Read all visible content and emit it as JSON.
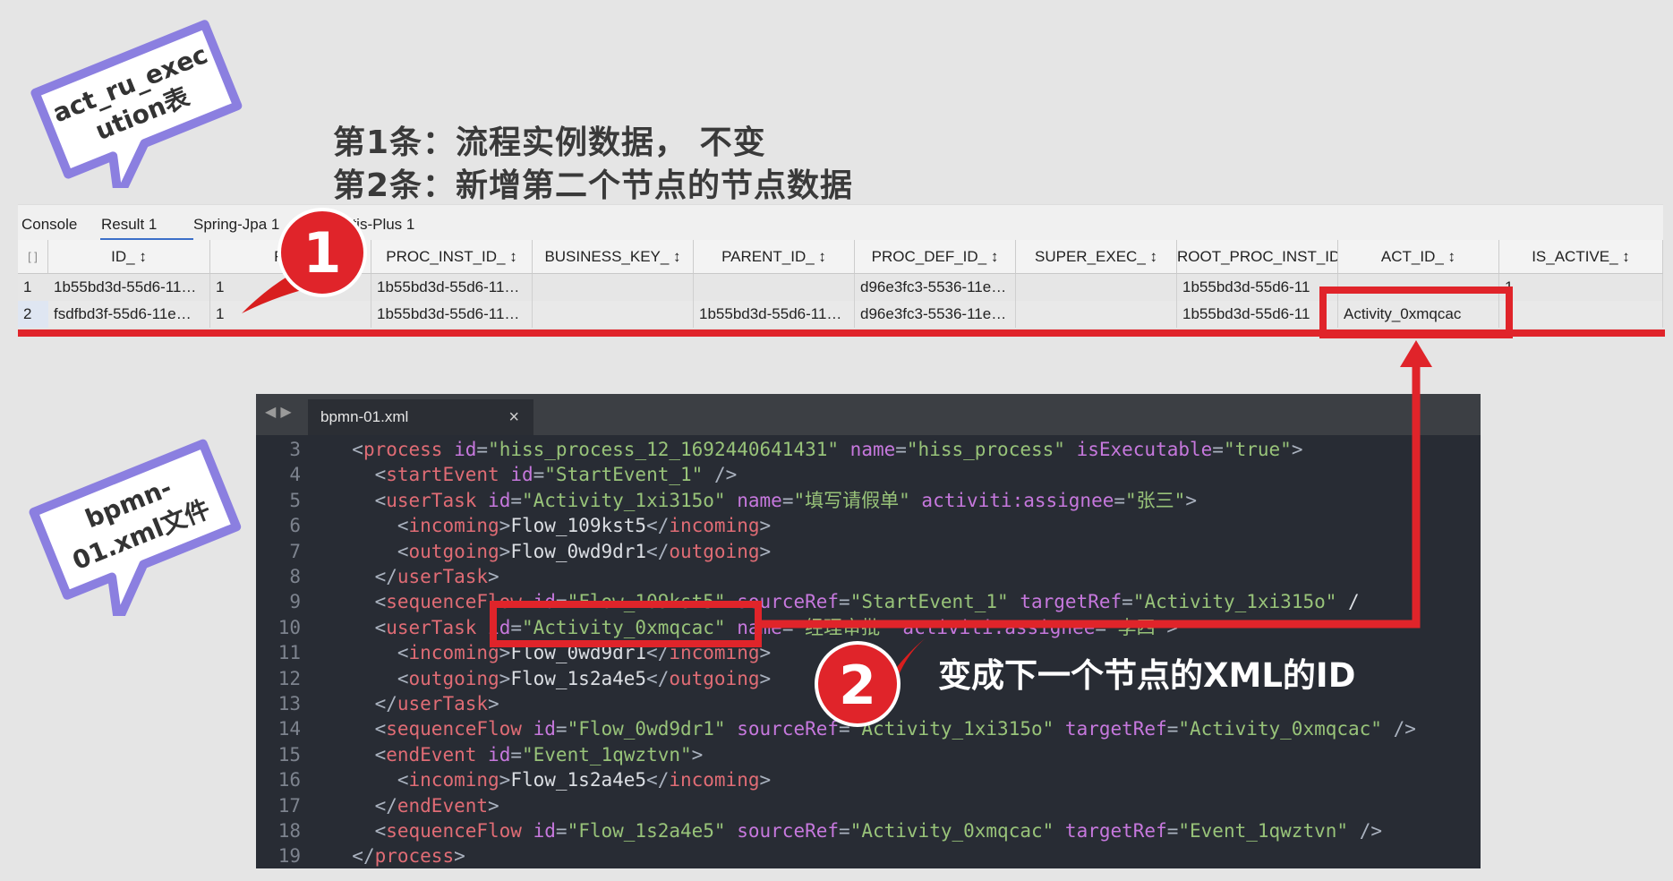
{
  "bubbles": {
    "top": "act_ru_exec\nution表",
    "bottom": "bpmn-\n01.xml文件"
  },
  "heading": {
    "line1": "第1条：流程实例数据， 不变",
    "line2": "第2条：新增第二个节点的节点数据"
  },
  "tabs": [
    "Console",
    "Result 1",
    "Spring-Jpa 1",
    "atis-Plus 1"
  ],
  "callout_numbers": [
    "1",
    "2"
  ],
  "annotation": "变成下一个节点的XML的ID",
  "table": {
    "row_header_icon": "[ ]",
    "columns": [
      "ID_",
      "RE",
      "PROC_INST_ID_",
      "BUSINESS_KEY_",
      "PARENT_ID_",
      "PROC_DEF_ID_",
      "SUPER_EXEC_",
      "ROOT_PROC_INST_ID_",
      "ACT_ID_",
      "IS_ACTIVE_"
    ],
    "rows": [
      {
        "num": "1",
        "cells": [
          "1b55bd3d-55d6-11…",
          "1",
          "1b55bd3d-55d6-11…",
          "",
          "",
          "d96e3fc3-5536-11e…",
          "",
          "1b55bd3d-55d6-11",
          "",
          "1"
        ]
      },
      {
        "num": "2",
        "cells": [
          "fsdfbd3f-55d6-11e…",
          "1",
          "1b55bd3d-55d6-11…",
          "",
          "1b55bd3d-55d6-11…",
          "d96e3fc3-5536-11e…",
          "",
          "1b55bd3d-55d6-11",
          "Activity_0xmqcac",
          ""
        ]
      }
    ]
  },
  "editor": {
    "tab": "bpmn-01.xml",
    "close": "×",
    "nav": "◀ ▶",
    "line_numbers": [
      "3",
      "4",
      "5",
      "6",
      "7",
      "8",
      "9",
      "10",
      "11",
      "12",
      "13",
      "14",
      "15",
      "16",
      "17",
      "18",
      "19"
    ],
    "lines": [
      "<process id=\"hiss_process_12_1692440641431\" name=\"hiss_process\" isExecutable=\"true\">",
      "  <startEvent id=\"StartEvent_1\" />",
      "  <userTask id=\"Activity_1xi315o\" name=\"填写请假单\" activiti:assignee=\"张三\">",
      "    <incoming>Flow_109kst5</incoming>",
      "    <outgoing>Flow_0wd9dr1</outgoing>",
      "  </userTask>",
      "  <sequenceFlow id=\"Flow_109kst5\" sourceRef=\"StartEvent_1\" targetRef=\"Activity_1xi315o\" /",
      "  <userTask id=\"Activity_0xmqcac\" name=\"经理审批\" activiti:assignee=\"李四\">",
      "    <incoming>Flow_0wd9dr1</incoming>",
      "    <outgoing>Flow_1s2a4e5</outgoing>",
      "  </userTask>",
      "  <sequenceFlow id=\"Flow_0wd9dr1\" sourceRef=\"Activity_1xi315o\" targetRef=\"Activity_0xmqcac\" />",
      "  <endEvent id=\"Event_1qwztvn\">",
      "    <incoming>Flow_1s2a4e5</incoming>",
      "  </endEvent>",
      "  <sequenceFlow id=\"Flow_1s2a4e5\" sourceRef=\"Activity_0xmqcac\" targetRef=\"Event_1qwztvn\" />",
      "</process>"
    ]
  },
  "colors": {
    "accent_red": "#e0242a",
    "bubble_purple": "#8b7fe0",
    "editor_bg": "#282c34"
  }
}
